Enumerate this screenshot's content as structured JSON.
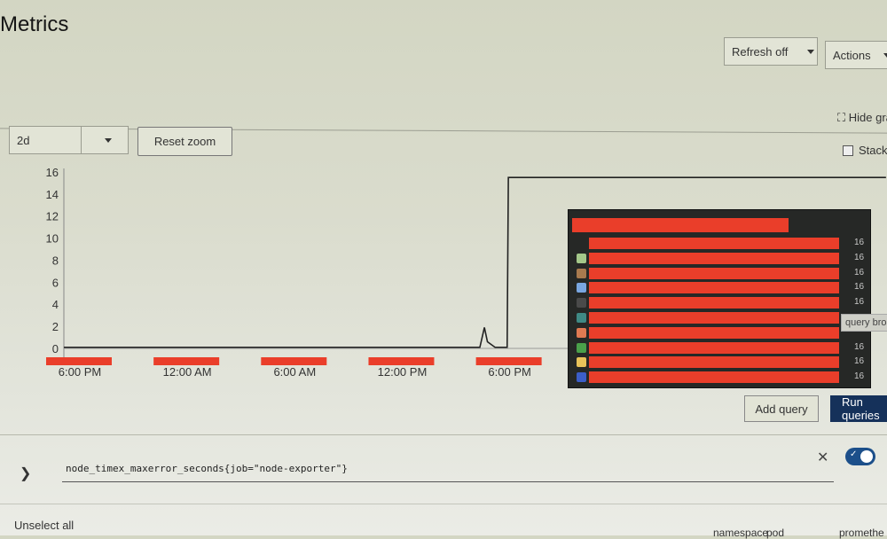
{
  "header": {
    "title": "Metrics",
    "refresh_label": "Refresh off",
    "actions_label": "Actions"
  },
  "graph_controls": {
    "hide_graph_label": "Hide graph",
    "range_value": "2d",
    "reset_zoom_label": "Reset zoom",
    "stacked_label": "Stacked",
    "stacked_checked": false
  },
  "chart_data": {
    "type": "line",
    "yticks": [
      "0",
      "2",
      "4",
      "6",
      "8",
      "10",
      "12",
      "14",
      "16"
    ],
    "ylim": [
      0,
      16
    ],
    "xticks": [
      "6:00 PM",
      "12:00 AM",
      "6:00 AM",
      "12:00 PM",
      "6:00 PM"
    ],
    "range": "2d",
    "series": [
      {
        "color": "#222222",
        "points": [
          [
            "5:05 PM",
            0.1
          ],
          [
            "4:00 PM",
            0.1
          ],
          [
            "4:15 PM",
            1.9
          ],
          [
            "4:25 PM",
            0.6
          ],
          [
            "4:35 PM",
            0.4
          ],
          [
            "4:50 PM",
            0.1
          ],
          [
            "5:30 PM",
            0.1
          ],
          [
            "5:34 PM",
            15.5
          ],
          [
            "2:20 PM",
            15.5
          ]
        ]
      }
    ]
  },
  "tooltip": {
    "rows": [
      {
        "color": "",
        "value": "16"
      },
      {
        "color": "#a4c88a",
        "value": "16"
      },
      {
        "color": "#a87a4e",
        "value": "16"
      },
      {
        "color": "#79a6e0",
        "value": "16"
      },
      {
        "color": "#4a4a4a",
        "value": "16"
      },
      {
        "color": "#3f8a85",
        "value": ""
      },
      {
        "color": "#e07a52",
        "value": ""
      },
      {
        "color": "#4aa04a",
        "value": "16"
      },
      {
        "color": "#e8c35a",
        "value": "16"
      },
      {
        "color": "#3c5ec8",
        "value": "16"
      }
    ],
    "hover_tip": "query bro"
  },
  "query_actions": {
    "add_query_label": "Add query",
    "run_queries_label": "Run queries"
  },
  "query": {
    "expression": "node_timex_maxerror_seconds{job=\"node-exporter\"}",
    "enabled": true,
    "clear_icon": "close-icon",
    "expand_icon": "chevron-down-icon"
  },
  "table": {
    "unselect_all_label": "Unselect all",
    "columns": [
      "namespace",
      "pod",
      "promethe"
    ]
  }
}
